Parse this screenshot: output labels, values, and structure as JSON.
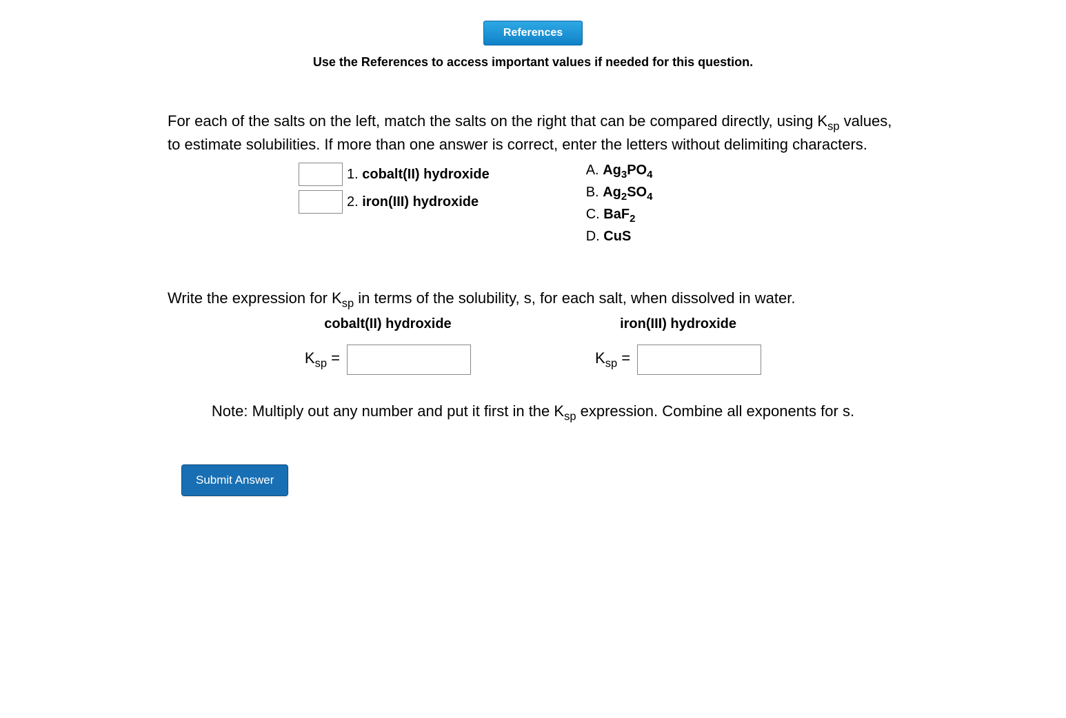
{
  "references": {
    "button": "References",
    "note": "Use the References to access important values if needed for this question."
  },
  "part1": {
    "intro_a": "For each of the salts on the left, match the salts on the right that can be compared directly, using K",
    "intro_sub": "sp",
    "intro_b": " values, to estimate solubilities. If more than one answer is correct, enter the letters without delimiting characters.",
    "left": [
      {
        "num": "1.",
        "name": "cobalt(II) hydroxide"
      },
      {
        "num": "2.",
        "name": "iron(III) hydroxide"
      }
    ],
    "right": [
      {
        "letter": "A.",
        "base": "Ag",
        "sub1": "3",
        "mid": "PO",
        "sub2": "4"
      },
      {
        "letter": "B.",
        "base": "Ag",
        "sub1": "2",
        "mid": "SO",
        "sub2": "4"
      },
      {
        "letter": "C.",
        "base": "BaF",
        "sub1": "2",
        "mid": "",
        "sub2": ""
      },
      {
        "letter": "D.",
        "base": "CuS",
        "sub1": "",
        "mid": "",
        "sub2": ""
      }
    ]
  },
  "part2": {
    "intro_a": "Write the expression for K",
    "intro_sub": "sp",
    "intro_b": " in terms of the solubility, s, for each salt, when dissolved in water.",
    "cols": [
      {
        "title": "cobalt(II) hydroxide",
        "Klabel": "K",
        "Ksub": "sp",
        "eq": " = "
      },
      {
        "title": "iron(III) hydroxide",
        "Klabel": "K",
        "Ksub": "sp",
        "eq": " = "
      }
    ],
    "note_a": "Note: Multiply out any number and put it first in the K",
    "note_sub": "sp",
    "note_b": " expression. Combine all exponents for s."
  },
  "submit": "Submit Answer"
}
